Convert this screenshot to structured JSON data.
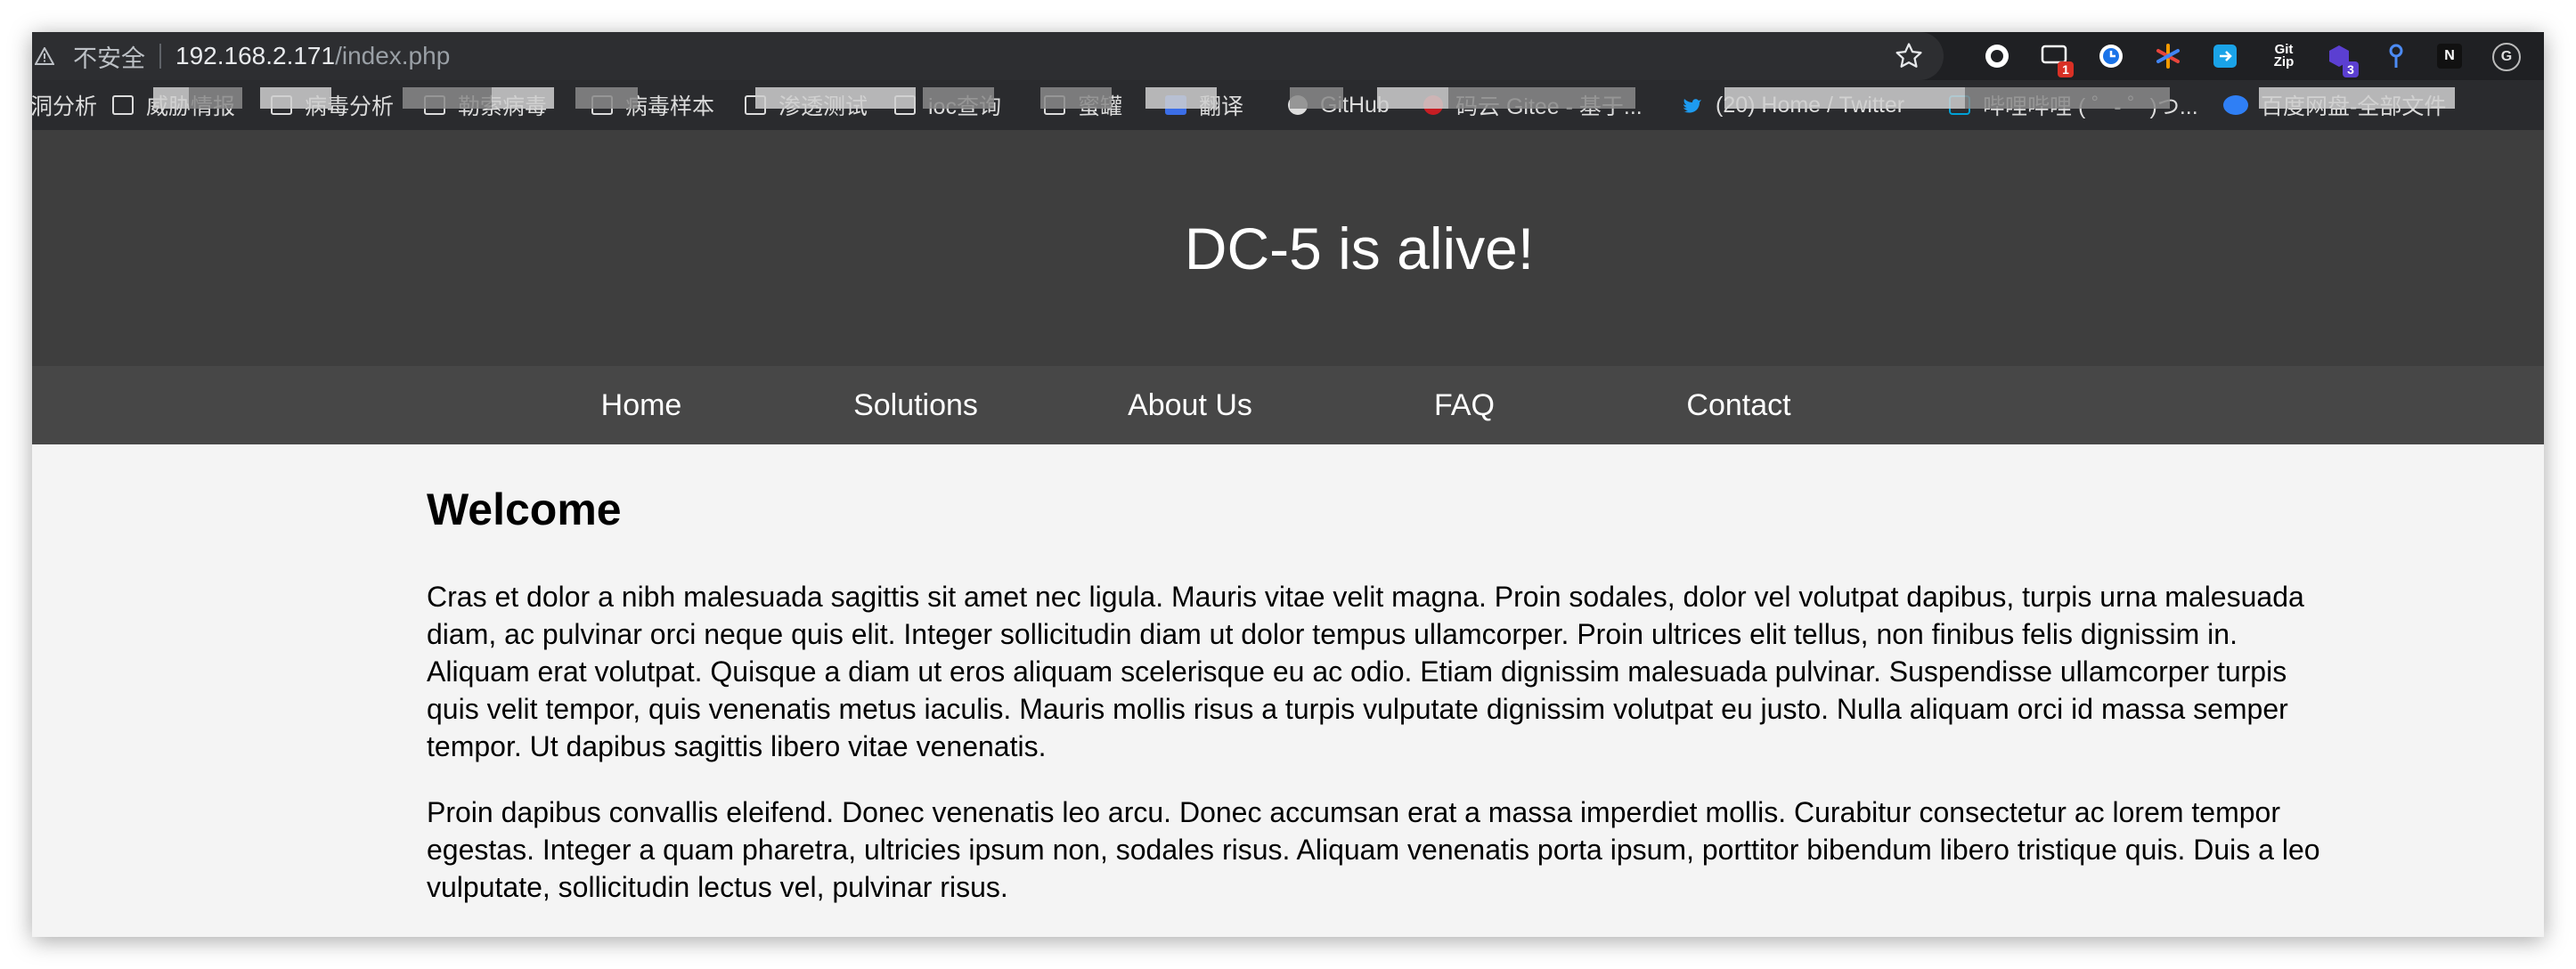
{
  "browser": {
    "insecure_label": "不安全",
    "url_host": "192.168.2.171",
    "url_path": "/index.php",
    "extensions": [
      {
        "name": "circle-extension",
        "label": "",
        "badge": ""
      },
      {
        "name": "screen-extension",
        "label": "",
        "badge": "1"
      },
      {
        "name": "clock-extension",
        "label": "",
        "badge": ""
      },
      {
        "name": "asterisk-extension",
        "label": "",
        "badge": ""
      },
      {
        "name": "share-extension",
        "label": "",
        "badge": ""
      },
      {
        "name": "gitzip-extension",
        "label": "Git Zip",
        "badge": ""
      },
      {
        "name": "cube-extension",
        "label": "",
        "badge": "3"
      },
      {
        "name": "pin-extension",
        "label": "",
        "badge": ""
      },
      {
        "name": "notion-extension",
        "label": "N",
        "badge": ""
      },
      {
        "name": "grammarly-extension",
        "label": "G",
        "badge": ""
      }
    ]
  },
  "bookmarks": [
    {
      "label": "洞分析",
      "icon": "none"
    },
    {
      "label": "威胁情报",
      "icon": "folder-icon"
    },
    {
      "label": "病毒分析",
      "icon": "folder-icon"
    },
    {
      "label": "勒索病毒",
      "icon": "folder-icon"
    },
    {
      "label": "病毒样本",
      "icon": "folder-icon"
    },
    {
      "label": "渗透测试",
      "icon": "folder-icon"
    },
    {
      "label": "ioc查询",
      "icon": "folder-icon"
    },
    {
      "label": "蜜罐",
      "icon": "folder-icon"
    },
    {
      "label": "翻译",
      "icon": "translate-icon"
    },
    {
      "label": "GitHub",
      "icon": "github-icon"
    },
    {
      "label": "码云 Gitee - 基于...",
      "icon": "gitee-icon"
    },
    {
      "label": "(20) Home / Twitter",
      "icon": "twitter-icon"
    },
    {
      "label": "哔哩哔哩 ( ゜- ゜)つ...",
      "icon": "bilibili-icon"
    },
    {
      "label": "百度网盘-全部文件",
      "icon": "baidu-icon"
    }
  ],
  "site": {
    "title": "DC-5 is alive!",
    "nav": [
      "Home",
      "Solutions",
      "About Us",
      "FAQ",
      "Contact"
    ],
    "heading": "Welcome",
    "paragraphs": [
      "Cras et dolor a nibh malesuada sagittis sit amet nec ligula. Mauris vitae velit magna. Proin sodales, dolor vel volutpat dapibus, turpis urna malesuada diam, ac pulvinar orci neque quis elit. Integer sollicitudin diam ut dolor tempus ullamcorper. Proin ultrices elit tellus, non finibus felis dignissim in. Aliquam erat volutpat. Quisque a diam ut eros aliquam scelerisque eu ac odio. Etiam dignissim malesuada pulvinar. Suspendisse ullamcorper turpis quis velit tempor, quis venenatis metus iaculis. Mauris mollis risus a turpis vulputate dignissim volutpat eu justo. Nulla aliquam orci id massa semper tempor. Ut dapibus sagittis libero vitae venenatis.",
      "Proin dapibus convallis eleifend. Donec venenatis leo arcu. Donec accumsan erat a massa imperdiet mollis. Curabitur consectetur ac lorem tempor egestas. Integer a quam pharetra, ultricies ipsum non, sodales risus. Aliquam venenatis porta ipsum, porttitor bibendum libero tristique quis. Duis a leo vulputate, sollicitudin lectus vel, pulvinar risus."
    ]
  },
  "colors": {
    "hero_bg": "#3e3e3e",
    "nav_bg": "#474747",
    "page_bg": "#f4f4f4"
  }
}
